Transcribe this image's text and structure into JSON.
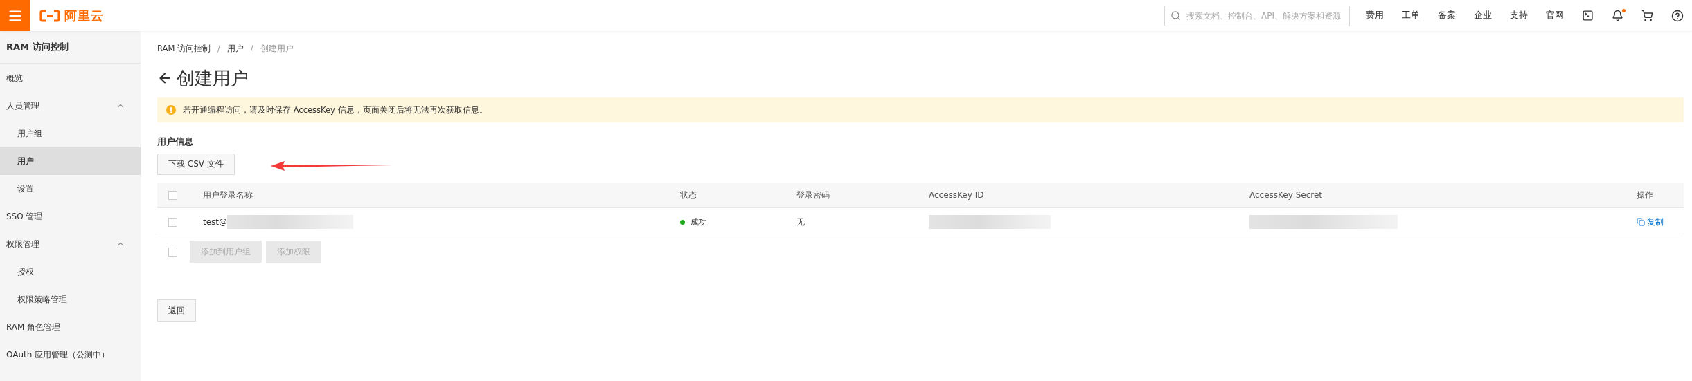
{
  "topbar": {
    "logo_text": "阿里云",
    "search": {
      "placeholder": "搜索文档、控制台、API、解决方案和资源"
    },
    "links": [
      "费用",
      "工单",
      "备案",
      "企业",
      "支持",
      "官网"
    ],
    "notification_unread": true
  },
  "sidebar": {
    "title": "RAM 访问控制",
    "items": [
      {
        "label": "概览",
        "selected": false
      },
      {
        "label": "人员管理",
        "expanded": true,
        "children": [
          {
            "label": "用户组",
            "selected": false
          },
          {
            "label": "用户",
            "selected": true
          },
          {
            "label": "设置",
            "selected": false
          }
        ]
      },
      {
        "label": "SSO 管理",
        "selected": false
      },
      {
        "label": "权限管理",
        "expanded": true,
        "children": [
          {
            "label": "授权",
            "selected": false
          },
          {
            "label": "权限策略管理",
            "selected": false
          }
        ]
      },
      {
        "label": "RAM 角色管理",
        "selected": false
      },
      {
        "label": "OAuth 应用管理（公测中）",
        "selected": false
      }
    ]
  },
  "breadcrumb": [
    "RAM 访问控制",
    "用户",
    "创建用户"
  ],
  "breadcrumb_separator": "/",
  "page_title": "创建用户",
  "alert": "若开通编程访问，请及时保存 AccessKey 信息，页面关闭后将无法再次获取信息。",
  "section_title": "用户信息",
  "download_button": "下载 CSV 文件",
  "table": {
    "header_checked": false,
    "columns": [
      "用户登录名称",
      "状态",
      "登录密码",
      "AccessKey ID",
      "AccessKey Secret",
      "操作"
    ],
    "rows": [
      {
        "checked": false,
        "login_name": "test@",
        "status": "成功",
        "password": "无",
        "action": "复制"
      }
    ],
    "footer_checked": false,
    "bulk_actions": [
      {
        "label": "添加到用户组",
        "disabled": true
      },
      {
        "label": "添加权限",
        "disabled": true
      }
    ]
  },
  "back_button": "返回"
}
